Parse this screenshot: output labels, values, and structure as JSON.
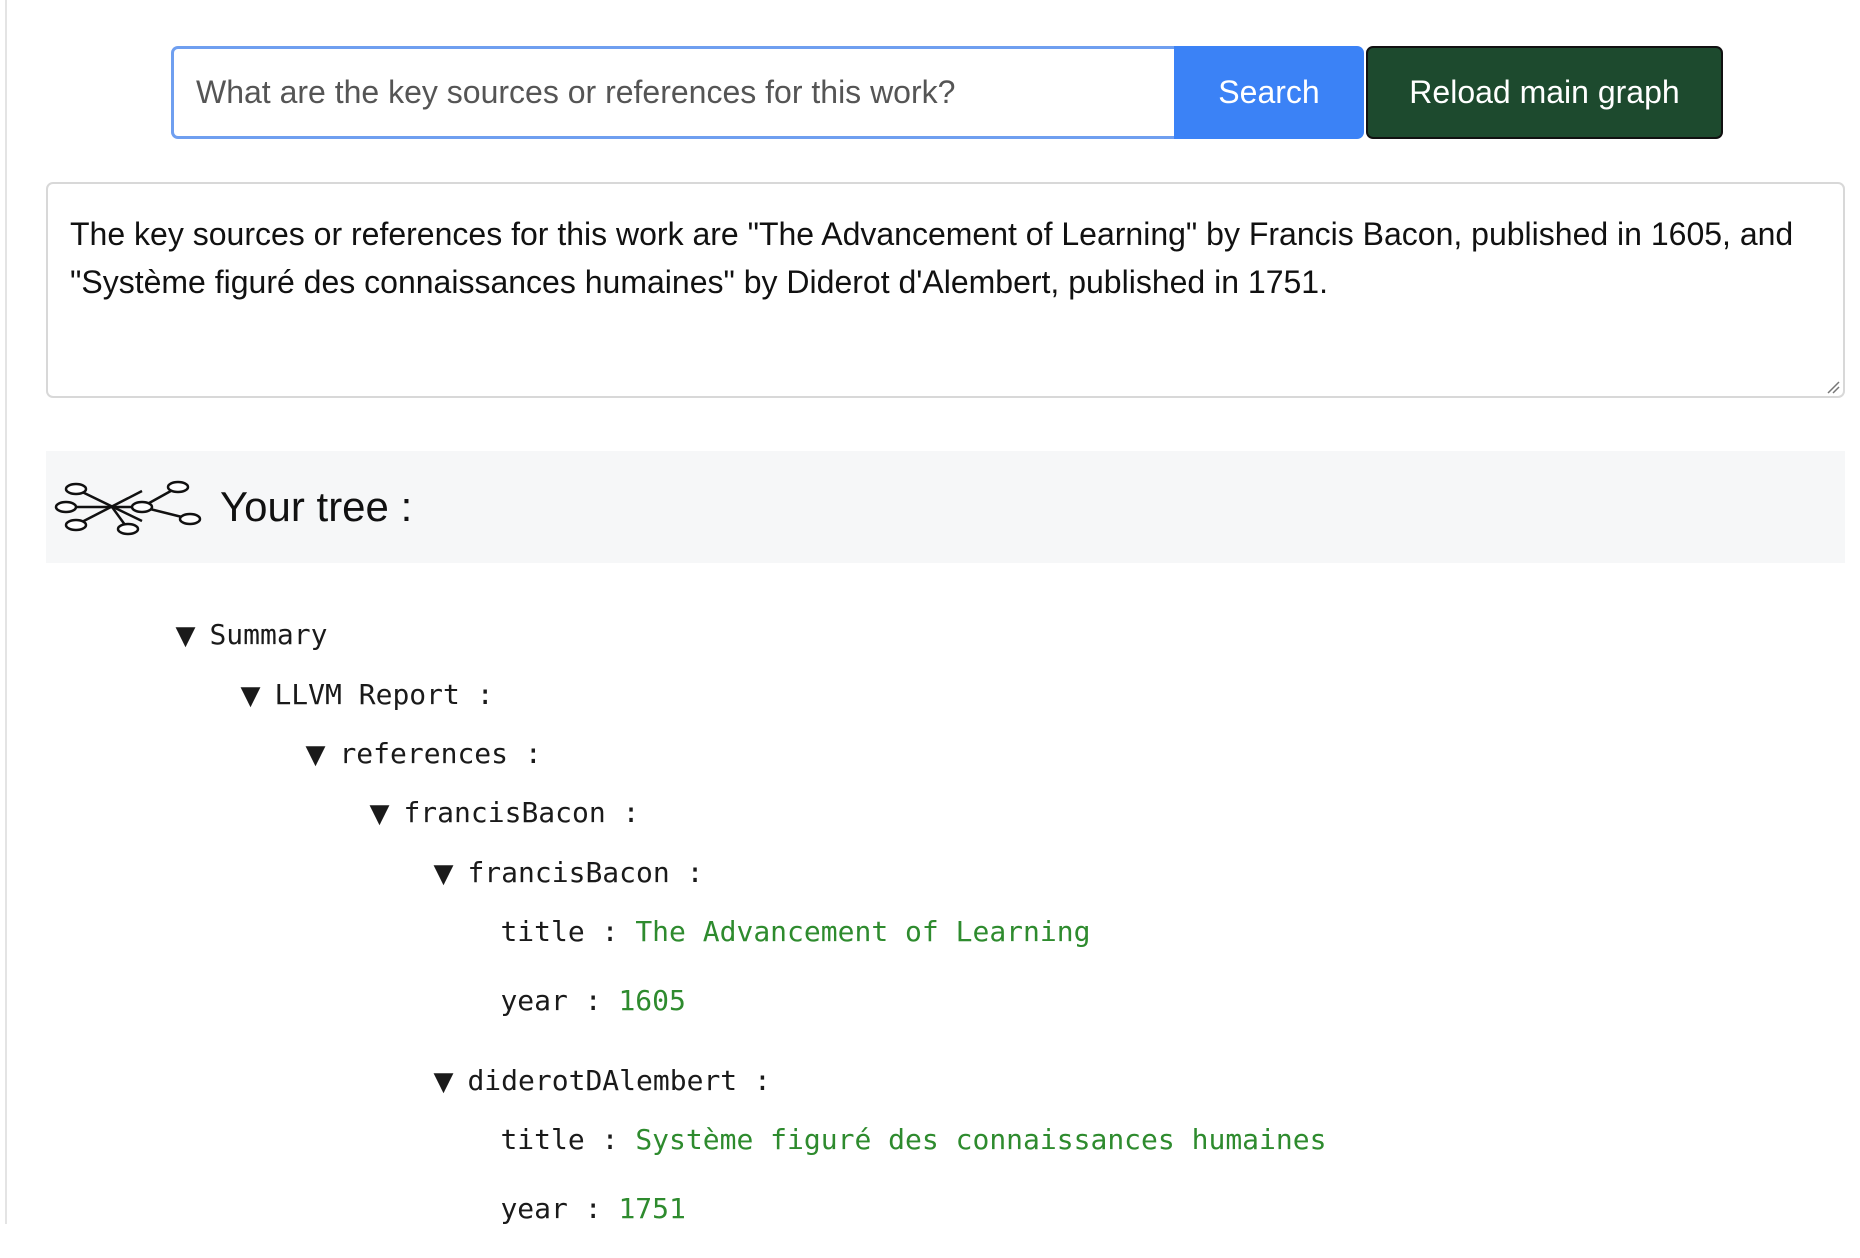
{
  "search": {
    "placeholder": "What are the key sources or references for this work?",
    "button_label": "Search",
    "reload_label": "Reload main graph"
  },
  "answer": {
    "text": "The key sources or references for this work are \"The Advancement of Learning\" by Francis Bacon, published in 1605, and \"Système figuré des connaissances humaines\" by Diderot d'Alembert, published in 1751."
  },
  "tree_header": {
    "title": "Your tree :",
    "icon": "tree-graph-icon"
  },
  "tree": {
    "caret": "▼",
    "separator": " :",
    "summary": "Summary",
    "report": "LLVM Report",
    "references": "references",
    "group": "francisBacon",
    "bacon": {
      "key": "francisBacon",
      "title_key": "title",
      "title_value": "The Advancement of Learning",
      "year_key": "year",
      "year_value": "1605"
    },
    "diderot": {
      "key": "diderotDAlembert",
      "title_key": "title",
      "title_value": "Système figuré des connaissances humaines",
      "year_key": "year",
      "year_value": "1751"
    }
  },
  "colors": {
    "search_button": "#3b82f6",
    "reload_button": "#1d4a2e",
    "value_text": "#2e8b2e"
  }
}
